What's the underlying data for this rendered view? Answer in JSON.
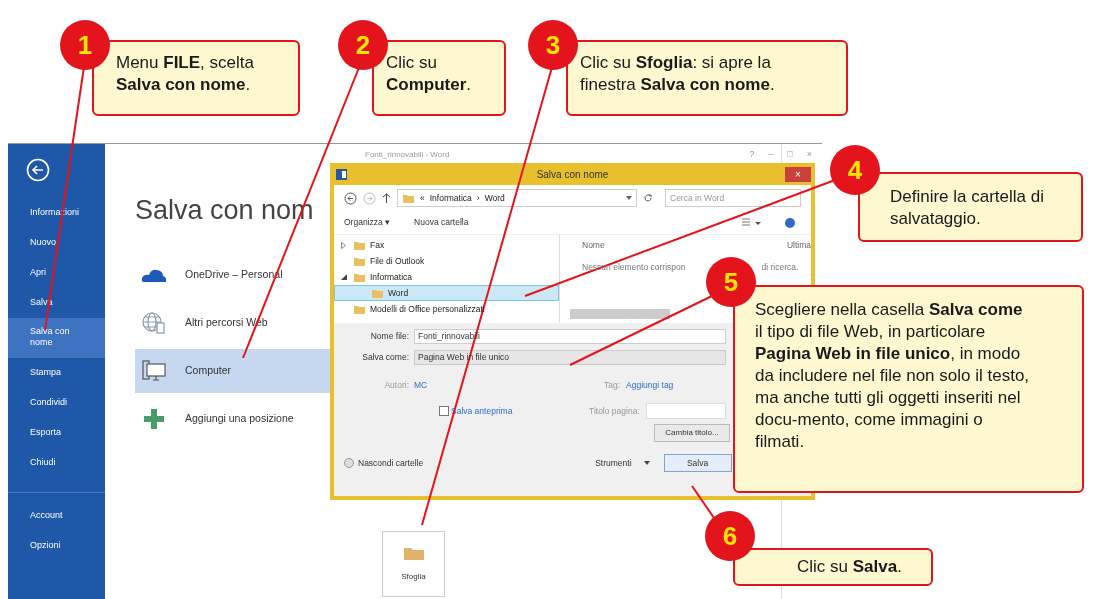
{
  "callouts": [
    {
      "number": "1",
      "text": "Menu **FILE**, scelta **Salva con nome**."
    },
    {
      "number": "2",
      "text": "Clic su **Computer**."
    },
    {
      "number": "3",
      "text": "Clic su **Sfoglia**: si apre la finestra **Salva con nome**."
    },
    {
      "number": "4",
      "text": "Definire la cartella di salvataggio."
    },
    {
      "number": "5",
      "text": "Scegliere nella casella **Salva come** il tipo di file Web, in particolare **Pagina Web in file unico**, in modo da includere nel file non solo il testo, ma anche tutti gli oggetti inseriti nel docu-mento, come immagini o filmati."
    },
    {
      "number": "6",
      "text": "Clic su **Salva**."
    }
  ],
  "backstage": {
    "window_title": "Fonti_rinnovabili - Word",
    "window_buttons": [
      "?",
      "–",
      "□",
      "×"
    ],
    "sidebar": [
      {
        "label": "Informazioni",
        "selected": false
      },
      {
        "label": "Nuovo",
        "selected": false
      },
      {
        "label": "Apri",
        "selected": false
      },
      {
        "label": "Salva",
        "selected": false
      },
      {
        "label": "Salva con nome",
        "selected": true
      },
      {
        "label": "Stampa",
        "selected": false
      },
      {
        "label": "Condividi",
        "selected": false
      },
      {
        "label": "Esporta",
        "selected": false
      },
      {
        "label": "Chiudi",
        "selected": false
      },
      {
        "label": "Account",
        "selected": false
      },
      {
        "label": "Opzioni",
        "selected": false
      }
    ],
    "heading": "Salva con nom",
    "places": [
      {
        "kind": "cloud",
        "label": "OneDrive – Personal",
        "selected": false
      },
      {
        "kind": "globe",
        "label": "Altri percorsi Web",
        "selected": false
      },
      {
        "kind": "computer",
        "label": "Computer",
        "selected": true
      },
      {
        "kind": "add",
        "label": "Aggiungi una posizione",
        "selected": false
      }
    ],
    "browse": "Sfoglia"
  },
  "dialog": {
    "title": "Salva con nome",
    "close": "×",
    "path": [
      "«",
      "Informatica",
      "›",
      "Word"
    ],
    "search": {
      "placeholder": "Cerca in Word"
    },
    "toolbar": [
      "Organizza ▾",
      "Nuova cartella"
    ],
    "tree": [
      {
        "label": "Fax",
        "expanded": false,
        "selected": false
      },
      {
        "label": "File di Outlook",
        "selected": false
      },
      {
        "label": "Informatica",
        "expanded": true,
        "selected": false,
        "children": [
          {
            "label": "Word",
            "selected": true
          }
        ]
      },
      {
        "label": "Modelli di Office personalizzati",
        "selected": false
      }
    ],
    "columns": [
      "Nome",
      "Ultima"
    ],
    "empty_message": [
      "Nessun elemento corrispon",
      "di ricerca."
    ],
    "file_name": {
      "label": "Nome file:",
      "value": "Fonti_rinnovabili"
    },
    "save_as": {
      "label": "Salva come:",
      "value": "Pagina Web in file unico"
    },
    "authors": {
      "label": "Autori:",
      "value": "MC"
    },
    "tags": {
      "label": "Tag:",
      "value": "Aggiungi tag"
    },
    "thumbnail": {
      "label": "Salva anteprima",
      "checked": false
    },
    "page_title": {
      "label": "Titolo pagina:"
    },
    "change_title": "Cambia titolo...",
    "hide_folders": "Nascondi cartelle",
    "tools": "Strumenti",
    "save": "Salva"
  }
}
